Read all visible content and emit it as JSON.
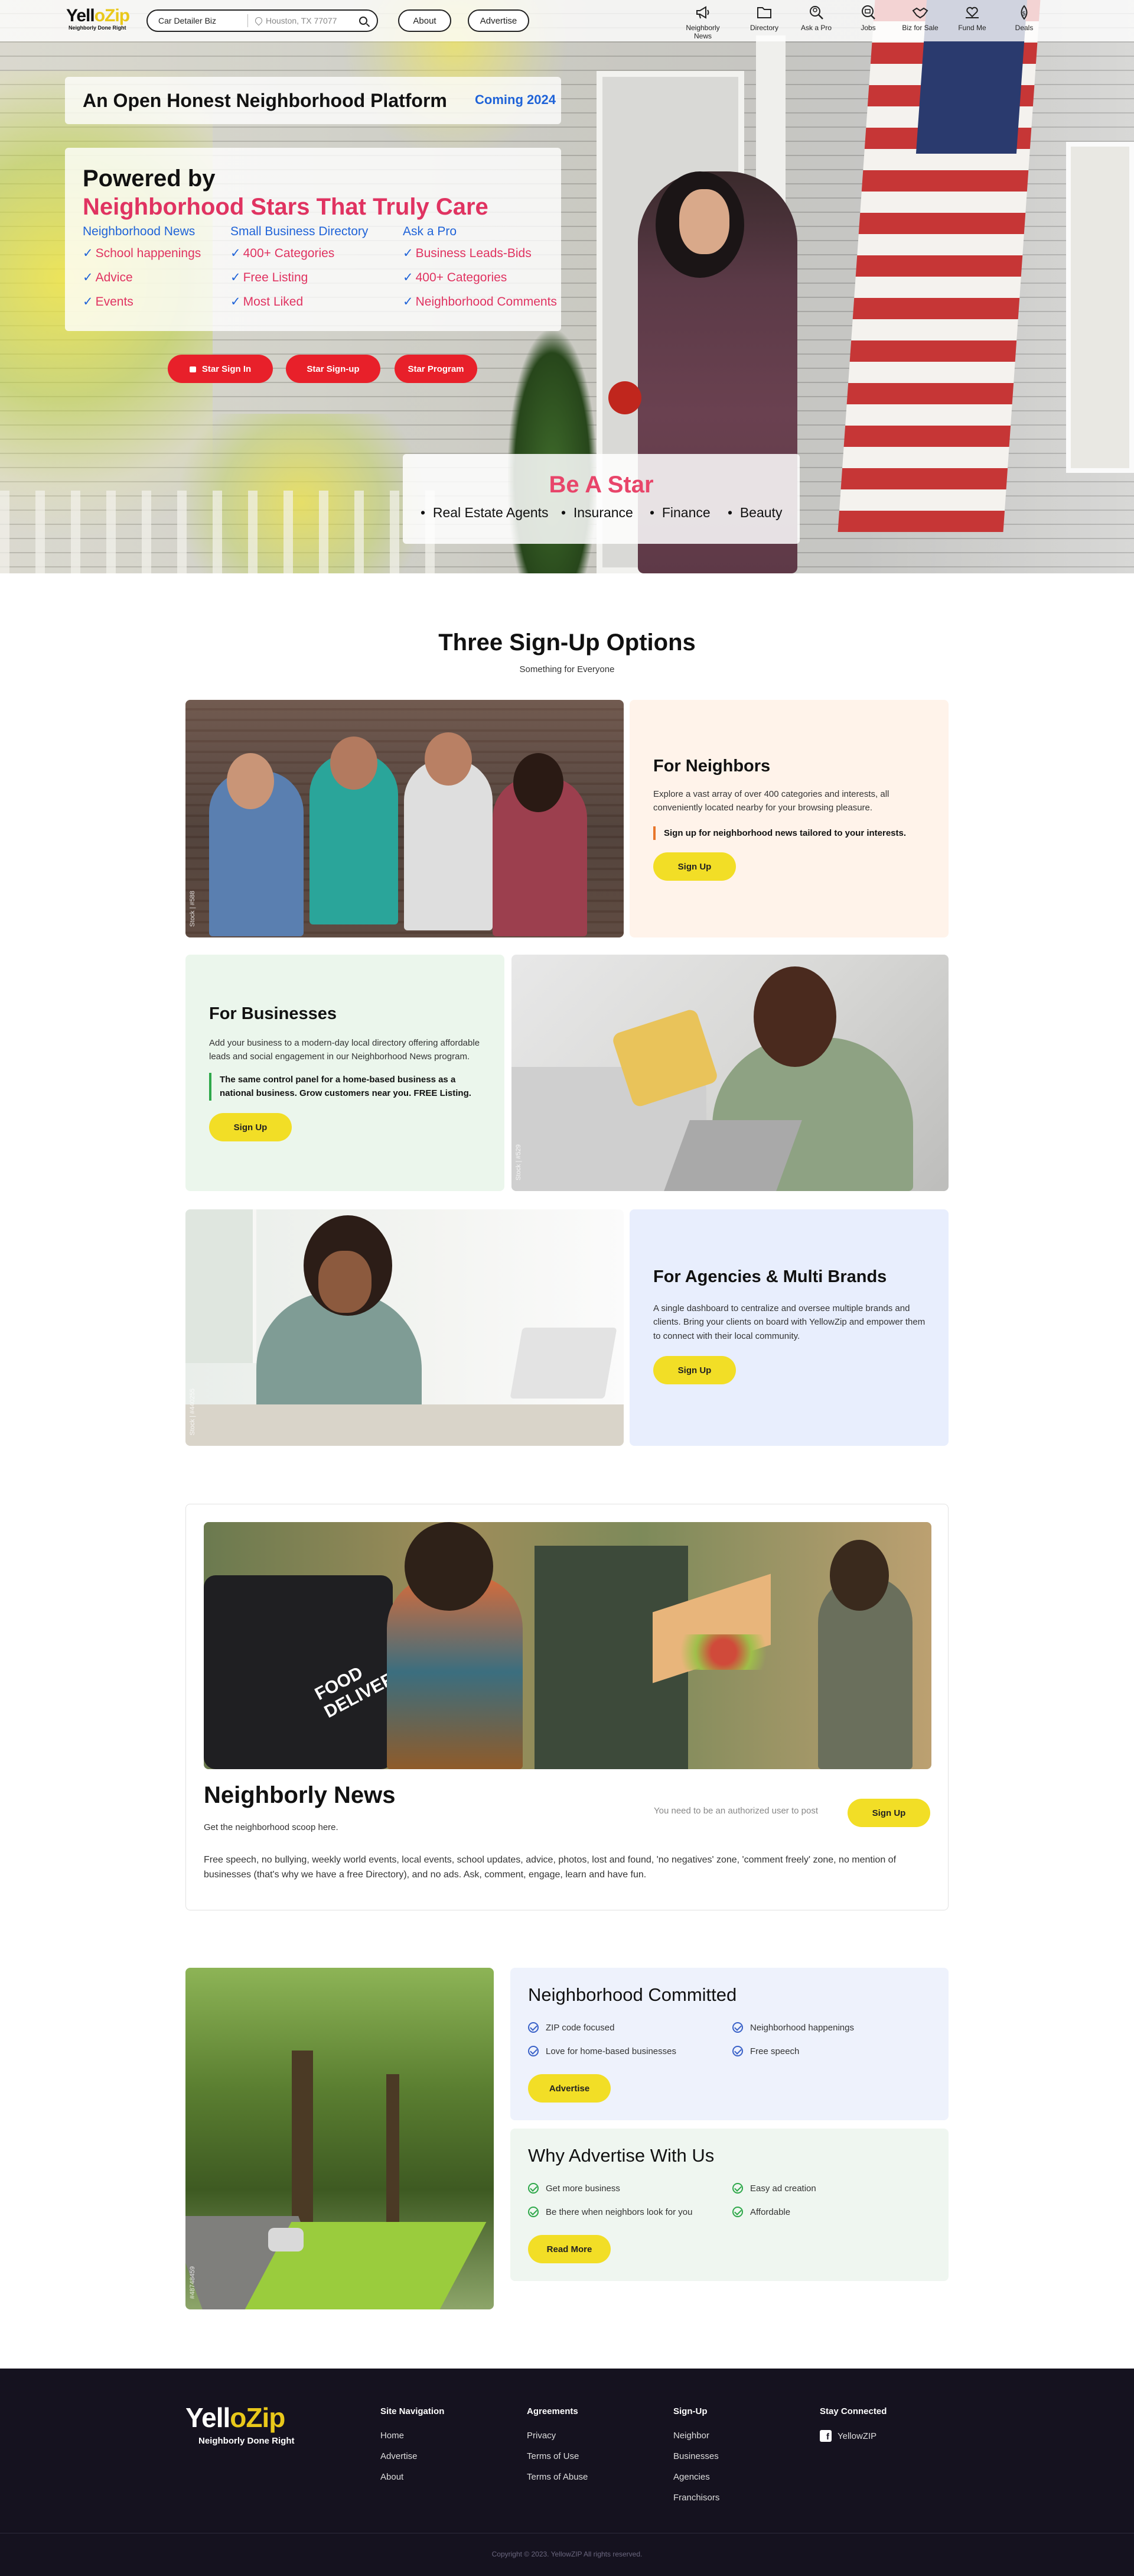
{
  "header": {
    "logo": {
      "part1": "Yell",
      "part2": "Zip",
      "o": "o",
      "tagline": "Neighborly Done Right"
    },
    "search_value": "Car Detailer Biz",
    "location_placeholder": "Houston, TX 77077",
    "about_label": "About",
    "advertise_label": "Advertise",
    "nav": [
      {
        "label": "Neighborly News",
        "icon": "megaphone-icon"
      },
      {
        "label": "Directory",
        "icon": "folder-icon"
      },
      {
        "label": "Ask a Pro",
        "icon": "search-person-icon"
      },
      {
        "label": "Jobs",
        "icon": "job-search-icon"
      },
      {
        "label": "Biz for Sale",
        "icon": "handshake-icon"
      },
      {
        "label": "Fund Me",
        "icon": "heart-hand-icon"
      },
      {
        "label": "Deals",
        "icon": "dollar-drop-icon"
      }
    ]
  },
  "hero": {
    "headline": "An Open Honest Neighborhood Platform",
    "coming": "Coming 2024",
    "powered_by": "Powered by",
    "stars_line": "Neighborhood Stars That Truly Care",
    "columns": [
      {
        "heading": "Neighborhood News",
        "items": [
          "School happenings",
          "Advice",
          "Events"
        ]
      },
      {
        "heading": "Small Business Directory",
        "items": [
          "400+ Categories",
          "Free Listing",
          "Most Liked"
        ]
      },
      {
        "heading": "Ask a Pro",
        "items": [
          "Business Leads-Bids",
          "400+ Categories",
          "Neighborhood Comments"
        ]
      }
    ],
    "check": "✓",
    "buttons": {
      "sign_in": "Star Sign In",
      "sign_up": "Star Sign-up",
      "program": "Star Program"
    },
    "be_a_star": {
      "title": "Be A Star",
      "items": [
        "Real Estate Agents",
        "Insurance",
        "Finance",
        "Beauty"
      ]
    }
  },
  "signup": {
    "title": "Three Sign-Up Options",
    "subtitle": "Something for Everyone",
    "cards": [
      {
        "title": "For Neighbors",
        "desc": "Explore a vast array of over 400 categories and interests, all conveniently located nearby for your browsing pleasure.",
        "quote": "Sign up for neighborhood news tailored to your interests.",
        "button": "Sign Up",
        "accent": "#e8752a",
        "bg": "#fff3ea",
        "stock": "Stock | #588"
      },
      {
        "title": "For Businesses",
        "desc": "Add your business to a modern-day local directory offering affordable leads and social engagement in our Neighborhood News program.",
        "quote": "The same control panel for a home-based business as a national business. Grow customers near you. FREE Listing.",
        "button": "Sign Up",
        "accent": "#2ea84a",
        "bg": "#ebf6ec",
        "stock": "Stock | #529"
      },
      {
        "title": "For Agencies & Multi Brands",
        "desc": "A single dashboard to centralize and oversee multiple brands and clients. Bring your clients on board with YellowZip and empower them to connect with their local community.",
        "button": "Sign Up",
        "bg": "#e8eefd",
        "stock": "Stock | #440255"
      }
    ]
  },
  "news": {
    "title": "Neighborly News",
    "subtitle": "Get the neighborhood scoop here.",
    "notice": "You need to be an authorized user to post",
    "button": "Sign Up",
    "body": "Free speech, no bullying, weekly world events, local events, school updates, advice, photos, lost and found, 'no negatives' zone, 'comment freely' zone, no mention of businesses (that's why we have a free Directory), and no ads. Ask, comment, engage, learn and have fun.",
    "image_text": [
      "FOOD",
      "DELIVERY"
    ]
  },
  "committed": {
    "title": "Neighborhood Committed",
    "items": [
      "ZIP code focused",
      "Neighborhood happenings",
      "Love for home-based businesses",
      "Free speech"
    ],
    "button": "Advertise",
    "stock": "#48748459"
  },
  "why": {
    "title": "Why Advertise With Us",
    "items": [
      "Get more business",
      "Easy ad creation",
      "Be there when neighbors look for you",
      "Affordable"
    ],
    "button": "Read More"
  },
  "footer": {
    "logo": {
      "part1": "Yell",
      "part2": "Zip",
      "o": "o",
      "tagline": "Neighborly Done Right"
    },
    "columns": [
      {
        "heading": "Site Navigation",
        "links": [
          "Home",
          "Advertise",
          "About"
        ]
      },
      {
        "heading": "Agreements",
        "links": [
          "Privacy",
          "Terms of Use",
          "Terms of Abuse"
        ]
      },
      {
        "heading": "Sign-Up",
        "links": [
          "Neighbor",
          "Businesses",
          "Agencies",
          "Franchisors"
        ]
      },
      {
        "heading": "Stay Connected",
        "links": [
          "YellowZIP"
        ]
      }
    ],
    "copyright": "Copyright © 2023. YellowZIP All rights reserved."
  },
  "colors": {
    "yellow": "#f2de26",
    "red": "#e8202a",
    "pink": "#e03361",
    "blue": "#1f63d8",
    "footer": "#15121f"
  }
}
